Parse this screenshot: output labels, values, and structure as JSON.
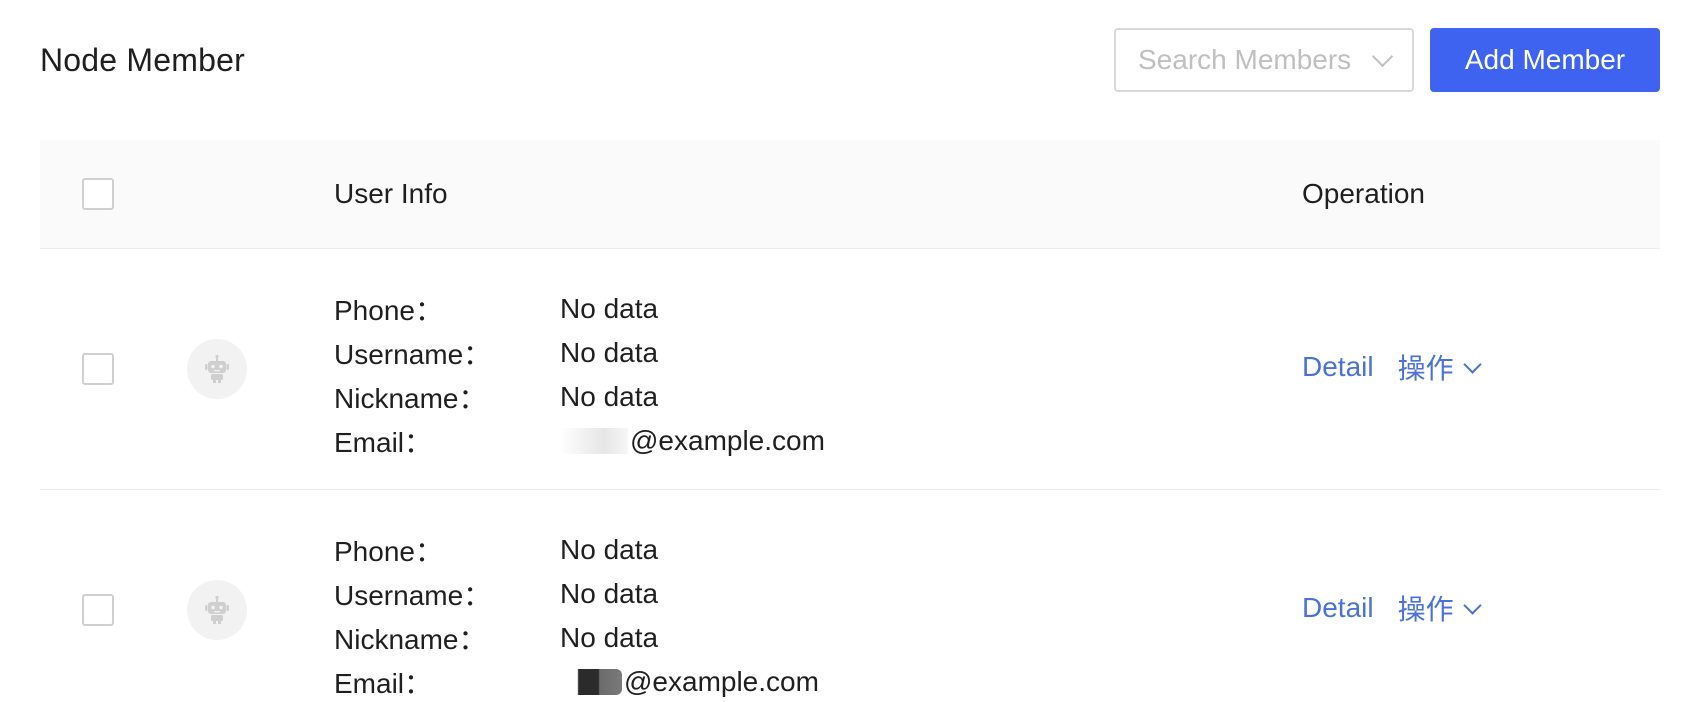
{
  "header": {
    "title": "Node Member",
    "search": {
      "placeholder": "Search Members"
    },
    "add_button_label": "Add Member",
    "accent_color": "#3d63f0"
  },
  "table": {
    "columns": {
      "user_info": "User Info",
      "operation": "Operation"
    },
    "labels": {
      "phone": "Phone：",
      "username": "Username：",
      "nickname": "Nickname：",
      "email": "Email："
    },
    "rows": [
      {
        "avatar_icon": "robot-icon",
        "phone": "No data",
        "username": "No data",
        "nickname": "No data",
        "email": "@example.com",
        "detail_label": "Detail",
        "more_label": "操作"
      },
      {
        "avatar_icon": "robot-icon",
        "phone": "No data",
        "username": "No data",
        "nickname": "No data",
        "email": "@example.com",
        "detail_label": "Detail",
        "more_label": "操作"
      }
    ]
  }
}
